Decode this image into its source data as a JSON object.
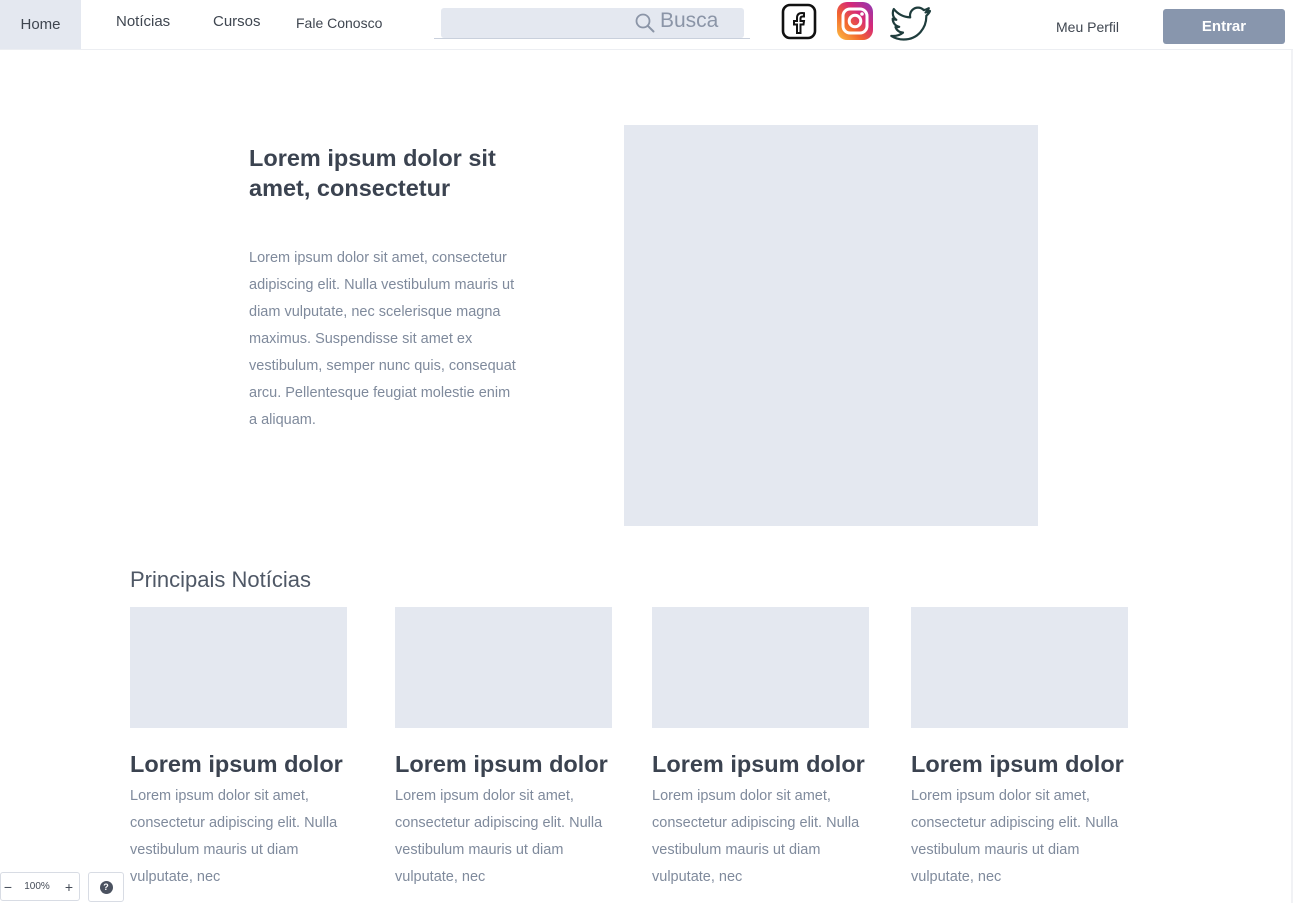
{
  "nav": {
    "home": "Home",
    "noticias": "Notícias",
    "cursos": "Cursos",
    "fale_conosco": "Fale Conosco",
    "search_placeholder": "Busca",
    "social_icons": [
      "facebook-icon",
      "instagram-icon",
      "twitter-icon"
    ],
    "profile": "Meu Perfil",
    "login": "Entrar"
  },
  "hero": {
    "title": "Lorem ipsum dolor sit amet, consectetur",
    "text": "Lorem ipsum dolor sit amet, consectetur adipiscing elit. Nulla vestibulum mauris ut diam vulputate, nec scelerisque magna maximus. Suspendisse sit amet ex vestibulum, semper nunc quis, consequat arcu. Pellentesque feugiat molestie enim a aliquam."
  },
  "news": {
    "section_title": "Principais Notícias",
    "cards": [
      {
        "title": "Lorem ipsum dolor",
        "text": "Lorem ipsum dolor sit amet, consectetur adipiscing elit. Nulla vestibulum mauris ut diam vulputate, nec"
      },
      {
        "title": "Lorem ipsum dolor",
        "text": "Lorem ipsum dolor sit amet, consectetur adipiscing elit. Nulla vestibulum mauris ut diam vulputate, nec"
      },
      {
        "title": "Lorem ipsum dolor",
        "text": "Lorem ipsum dolor sit amet, consectetur adipiscing elit. Nulla vestibulum mauris ut diam vulputate, nec"
      },
      {
        "title": "Lorem ipsum dolor",
        "text": "Lorem ipsum dolor sit amet, consectetur adipiscing elit. Nulla vestibulum mauris ut diam vulputate, nec"
      }
    ]
  },
  "zoom": {
    "minus": "−",
    "value": "100%",
    "plus": "+",
    "help": "?"
  },
  "colors": {
    "placeholder": "#e4e8f0",
    "button": "#8896ad",
    "heading": "#3b4350",
    "body_text": "#7f8a9c"
  }
}
